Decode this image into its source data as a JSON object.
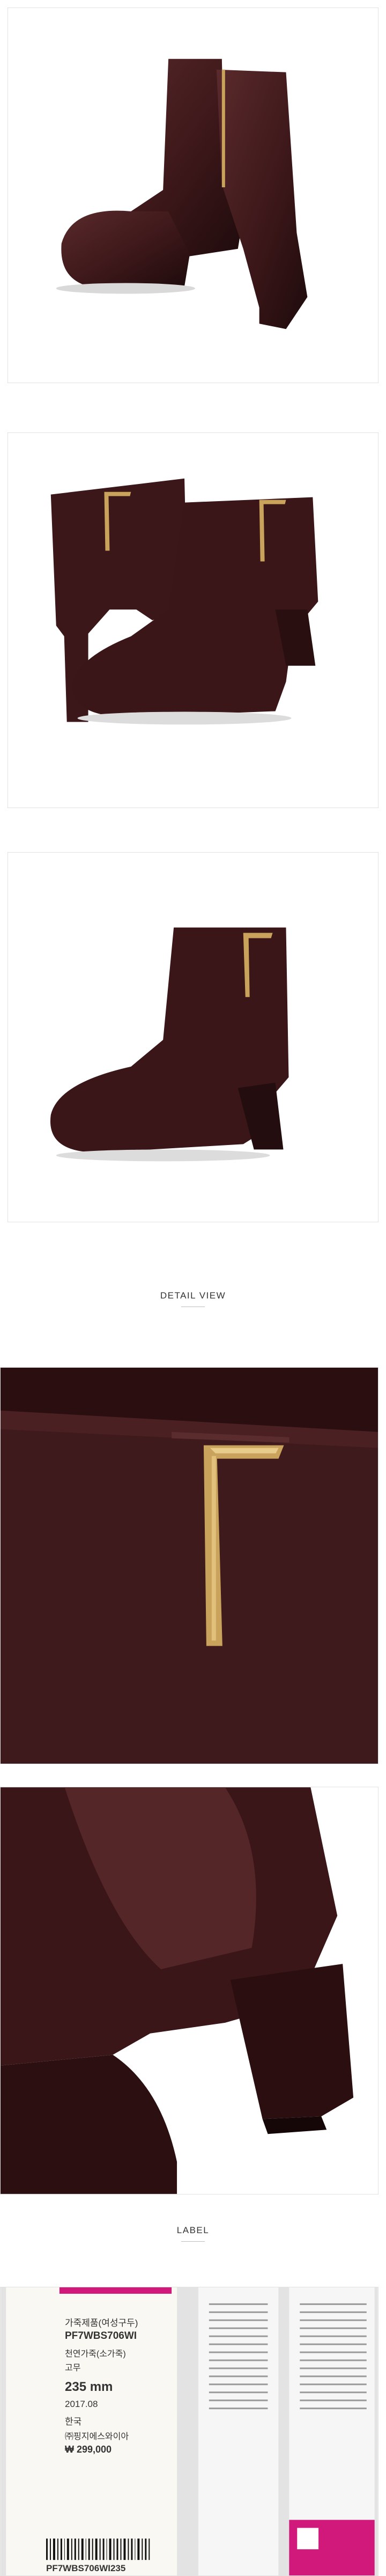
{
  "sections": {
    "detail_view_title": "DETAIL VIEW",
    "label_title": "LABEL"
  },
  "images": [
    {
      "name": "boots-pair-front",
      "icon": "boot-photo"
    },
    {
      "name": "boots-pair-side",
      "icon": "boot-photo"
    },
    {
      "name": "boot-single-side",
      "icon": "boot-photo"
    },
    {
      "name": "detail-gold-trim-closeup",
      "icon": "boot-photo"
    },
    {
      "name": "detail-heel-closeup",
      "icon": "boot-photo"
    },
    {
      "name": "label-tags-photo",
      "icon": "label-photo"
    }
  ],
  "label": {
    "category": "가죽제품(여성구두)",
    "model": "PF7WBS706WI",
    "material": "천연가죽(소가죽)",
    "sole": "고무",
    "size": "235 mm",
    "date": "2017.08",
    "origin": "한국",
    "importer": "㈜핑지에스와이아",
    "price": "₩ 299,000",
    "barcode_text": "PF7WBS706WI235"
  },
  "colors": {
    "leather": "#3a1618",
    "gold_trim": "#c9a35b",
    "label_pink": "#d0197a"
  }
}
